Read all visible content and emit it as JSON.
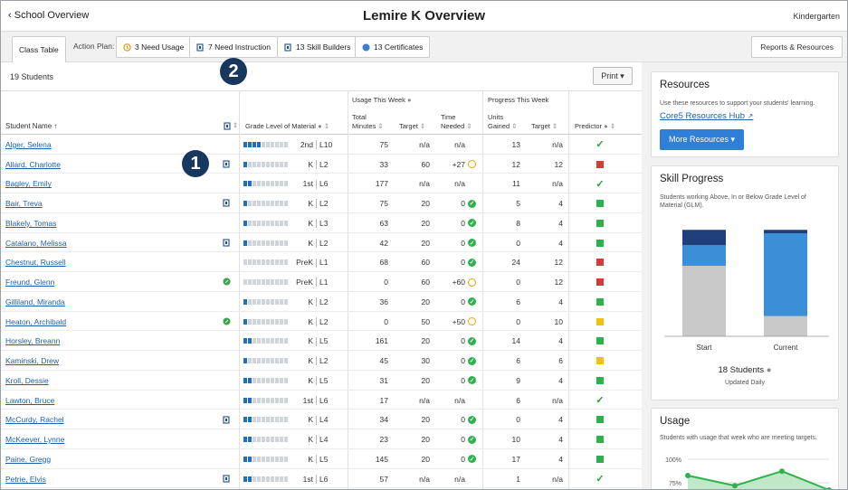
{
  "header": {
    "back": "School Overview",
    "title": "Lemire K Overview",
    "grade": "Kindergarten"
  },
  "tabs": {
    "class_table": "Class Table",
    "action_plan": "Action Plan:",
    "need_usage": "3 Need Usage",
    "need_instruction": "7 Need Instruction",
    "skill_builders": "13 Skill Builders",
    "certificates": "13 Certificates",
    "reports": "Reports & Resources"
  },
  "table_top": {
    "count": "19 Students",
    "print": "Print ▾"
  },
  "callouts": {
    "one": "1",
    "two": "2"
  },
  "columns": {
    "student": "Student Name ↑",
    "glm": "Grade Level of Material",
    "usage": "Usage This Week",
    "progress": "Progress This Week",
    "total1": "Total",
    "total2": "Minutes",
    "target": "Target",
    "time1": "Time",
    "time2": "Needed",
    "units1": "Units",
    "units2": "Gained",
    "target2": "Target",
    "predictor": "Predictor"
  },
  "rows": [
    {
      "name": "Alger, Selena",
      "icon": "",
      "fill": 4,
      "glm": "2nd",
      "level": "L10",
      "min": "75",
      "target": "n/a",
      "needed": "n/a",
      "status": "",
      "units": "13",
      "ptarget": "n/a",
      "pred": "check"
    },
    {
      "name": "Allard, Charlotte",
      "icon": "book",
      "fill": 1,
      "glm": "K",
      "level": "L2",
      "min": "33",
      "target": "60",
      "needed": "+27",
      "status": "clock",
      "units": "12",
      "ptarget": "12",
      "pred": "red"
    },
    {
      "name": "Bagley, Emily",
      "icon": "",
      "fill": 2,
      "glm": "1st",
      "level": "L6",
      "min": "177",
      "target": "n/a",
      "needed": "n/a",
      "status": "",
      "units": "11",
      "ptarget": "n/a",
      "pred": "check"
    },
    {
      "name": "Bair, Treva",
      "icon": "book",
      "fill": 1,
      "glm": "K",
      "level": "L2",
      "min": "75",
      "target": "20",
      "needed": "0",
      "status": "ok",
      "units": "5",
      "ptarget": "4",
      "pred": "green"
    },
    {
      "name": "Blakely, Tomas",
      "icon": "",
      "fill": 1,
      "glm": "K",
      "level": "L3",
      "min": "63",
      "target": "20",
      "needed": "0",
      "status": "ok",
      "units": "8",
      "ptarget": "4",
      "pred": "green"
    },
    {
      "name": "Catalano, Melissa",
      "icon": "book",
      "fill": 1,
      "glm": "K",
      "level": "L2",
      "min": "42",
      "target": "20",
      "needed": "0",
      "status": "ok",
      "units": "0",
      "ptarget": "4",
      "pred": "green"
    },
    {
      "name": "Chestnut, Russell",
      "icon": "",
      "fill": 0,
      "glm": "PreK",
      "level": "L1",
      "min": "68",
      "target": "60",
      "needed": "0",
      "status": "ok",
      "units": "24",
      "ptarget": "12",
      "pred": "red"
    },
    {
      "name": "Freund, Glenn",
      "icon": "leaf",
      "fill": 0,
      "glm": "PreK",
      "level": "L1",
      "min": "0",
      "target": "60",
      "needed": "+60",
      "status": "clock",
      "units": "0",
      "ptarget": "12",
      "pred": "red"
    },
    {
      "name": "Gilliland, Miranda",
      "icon": "",
      "fill": 1,
      "glm": "K",
      "level": "L2",
      "min": "36",
      "target": "20",
      "needed": "0",
      "status": "ok",
      "units": "6",
      "ptarget": "4",
      "pred": "green"
    },
    {
      "name": "Heaton, Archibald",
      "icon": "leaf",
      "fill": 1,
      "glm": "K",
      "level": "L2",
      "min": "0",
      "target": "50",
      "needed": "+50",
      "status": "clock",
      "units": "0",
      "ptarget": "10",
      "pred": "yellow"
    },
    {
      "name": "Horsley, Breann",
      "icon": "",
      "fill": 2,
      "glm": "K",
      "level": "L5",
      "min": "161",
      "target": "20",
      "needed": "0",
      "status": "ok",
      "units": "14",
      "ptarget": "4",
      "pred": "green"
    },
    {
      "name": "Kaminski, Drew",
      "icon": "",
      "fill": 1,
      "glm": "K",
      "level": "L2",
      "min": "45",
      "target": "30",
      "needed": "0",
      "status": "ok",
      "units": "6",
      "ptarget": "6",
      "pred": "yellow"
    },
    {
      "name": "Kroll, Dessie",
      "icon": "",
      "fill": 2,
      "glm": "K",
      "level": "L5",
      "min": "31",
      "target": "20",
      "needed": "0",
      "status": "ok",
      "units": "9",
      "ptarget": "4",
      "pred": "green"
    },
    {
      "name": "Lawton, Bruce",
      "icon": "",
      "fill": 2,
      "glm": "1st",
      "level": "L6",
      "min": "17",
      "target": "n/a",
      "needed": "n/a",
      "status": "",
      "units": "6",
      "ptarget": "n/a",
      "pred": "check"
    },
    {
      "name": "McCurdy, Rachel",
      "icon": "book",
      "fill": 2,
      "glm": "K",
      "level": "L4",
      "min": "34",
      "target": "20",
      "needed": "0",
      "status": "ok",
      "units": "0",
      "ptarget": "4",
      "pred": "green"
    },
    {
      "name": "McKeever, Lynne",
      "icon": "",
      "fill": 2,
      "glm": "K",
      "level": "L4",
      "min": "23",
      "target": "20",
      "needed": "0",
      "status": "ok",
      "units": "10",
      "ptarget": "4",
      "pred": "green"
    },
    {
      "name": "Paine, Gregg",
      "icon": "",
      "fill": 2,
      "glm": "K",
      "level": "L5",
      "min": "145",
      "target": "20",
      "needed": "0",
      "status": "ok",
      "units": "17",
      "ptarget": "4",
      "pred": "green"
    },
    {
      "name": "Petrie, Elvis",
      "icon": "book",
      "fill": 2,
      "glm": "1st",
      "level": "L6",
      "min": "57",
      "target": "n/a",
      "needed": "n/a",
      "status": "",
      "units": "1",
      "ptarget": "n/a",
      "pred": "check"
    }
  ],
  "colors": {
    "link": "#1f5fa8",
    "green": "#2bb24c",
    "red": "#d63b36",
    "yellow": "#f4c20d",
    "check": "#2a9d3c",
    "clock": "#f0a500",
    "navy": "#1e3f7a",
    "blue": "#3a8fd6",
    "gray": "#c8c8c8"
  },
  "resources": {
    "title": "Resources",
    "text": "Use these resources to support your students' learning.",
    "hub": "Core5 Resources Hub",
    "more": "More Resources ▾"
  },
  "skill": {
    "title": "Skill Progress",
    "text1": "Students working Above, In or Below Grade Level of",
    "text2": "Material (GLM).",
    "students": "18 Students",
    "updated": "Updated Daily"
  },
  "usage": {
    "title": "Usage",
    "text": "Students with usage that week who are meeting targets."
  },
  "chart_data": [
    {
      "type": "bar",
      "stacked": true,
      "categories": [
        "Start",
        "Current"
      ],
      "series": [
        {
          "values": [
            12,
            2
          ]
        },
        {
          "values": [
            16,
            49
          ]
        },
        {
          "values": [
            55,
            12
          ]
        },
        {
          "values": [
            5,
            16
          ]
        }
      ],
      "ylim": [
        0,
        100
      ],
      "note": "series ordered bottom to top: below (gray), in (blue), above (navy); estimated percentages"
    },
    {
      "type": "line",
      "x": [
        1,
        2,
        3,
        4
      ],
      "values": [
        80,
        73,
        83,
        70
      ],
      "ylim": [
        70,
        100
      ],
      "yticks": [
        "100%",
        "75%"
      ]
    }
  ]
}
